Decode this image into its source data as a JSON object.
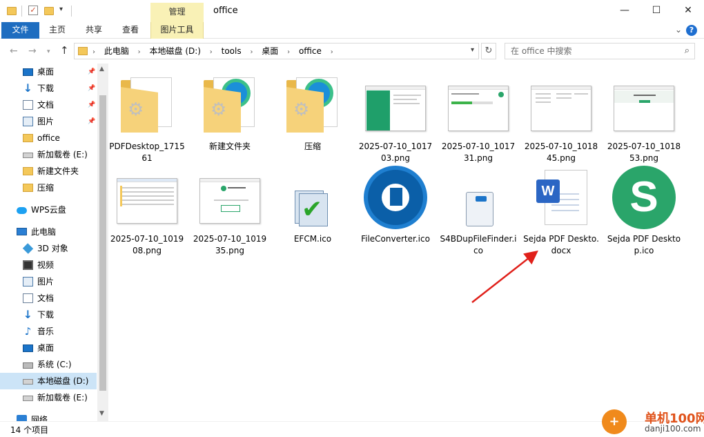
{
  "window": {
    "title": "office",
    "context_tab": "管理",
    "controls": {
      "minimize": "—",
      "maximize": "☐",
      "close": "✕"
    }
  },
  "ribbon": {
    "tabs": [
      "文件",
      "主页",
      "共享",
      "查看",
      "图片工具"
    ],
    "expand": "⌄",
    "help": "?"
  },
  "address": {
    "breadcrumbs": [
      "此电脑",
      "本地磁盘 (D:)",
      "tools",
      "桌面",
      "office"
    ],
    "search_placeholder": "在 office 中搜索"
  },
  "sidebar": {
    "items": [
      {
        "label": "桌面",
        "icon": "desktop-icon",
        "pinned": true
      },
      {
        "label": "下载",
        "icon": "download-icon",
        "pinned": true
      },
      {
        "label": "文档",
        "icon": "document-icon",
        "pinned": true
      },
      {
        "label": "图片",
        "icon": "picture-icon",
        "pinned": true
      },
      {
        "label": "office",
        "icon": "folder-icon"
      },
      {
        "label": "新加载卷 (E:)",
        "icon": "drive-icon"
      },
      {
        "label": "新建文件夹",
        "icon": "folder-icon"
      },
      {
        "label": "压缩",
        "icon": "folder-icon"
      },
      {
        "label": "WPS云盘",
        "icon": "cloud-icon"
      },
      {
        "label": "此电脑",
        "icon": "computer-icon"
      },
      {
        "label": "3D 对象",
        "icon": "3d-objects-icon"
      },
      {
        "label": "视频",
        "icon": "video-icon"
      },
      {
        "label": "图片",
        "icon": "picture-icon"
      },
      {
        "label": "文档",
        "icon": "document-icon"
      },
      {
        "label": "下载",
        "icon": "download-icon"
      },
      {
        "label": "音乐",
        "icon": "music-icon"
      },
      {
        "label": "桌面",
        "icon": "desktop-icon"
      },
      {
        "label": "系统 (C:)",
        "icon": "system-drive-icon"
      },
      {
        "label": "本地磁盘 (D:)",
        "icon": "drive-icon",
        "selected": true
      },
      {
        "label": "新加载卷 (E:)",
        "icon": "drive-icon"
      },
      {
        "label": "网络",
        "icon": "network-icon"
      }
    ]
  },
  "files": [
    {
      "name": "PDFDesktop_171561",
      "kind": "folder"
    },
    {
      "name": "新建文件夹",
      "kind": "folder-edge"
    },
    {
      "name": "压缩",
      "kind": "folder-edge"
    },
    {
      "name": "2025-07-10_101703.png",
      "kind": "shot-green"
    },
    {
      "name": "2025-07-10_101731.png",
      "kind": "shot-progress"
    },
    {
      "name": "2025-07-10_101845.png",
      "kind": "shot-list"
    },
    {
      "name": "2025-07-10_101853.png",
      "kind": "shot-web"
    },
    {
      "name": "2025-07-10_101908.png",
      "kind": "shot-table"
    },
    {
      "name": "2025-07-10_101935.png",
      "kind": "shot-complete"
    },
    {
      "name": "EFCM.ico",
      "kind": "efcm"
    },
    {
      "name": "FileConverter.ico",
      "kind": "fileconverter"
    },
    {
      "name": "S4BDupFileFinder.ico",
      "kind": "s4b"
    },
    {
      "name": "Sejda PDF Deskto.docx",
      "kind": "word"
    },
    {
      "name": "Sejda PDF Desktop.ico",
      "kind": "sejda"
    }
  ],
  "status": {
    "item_count": "14 个项目"
  },
  "watermark": {
    "title": "单机100网",
    "url": "danji100.com"
  }
}
